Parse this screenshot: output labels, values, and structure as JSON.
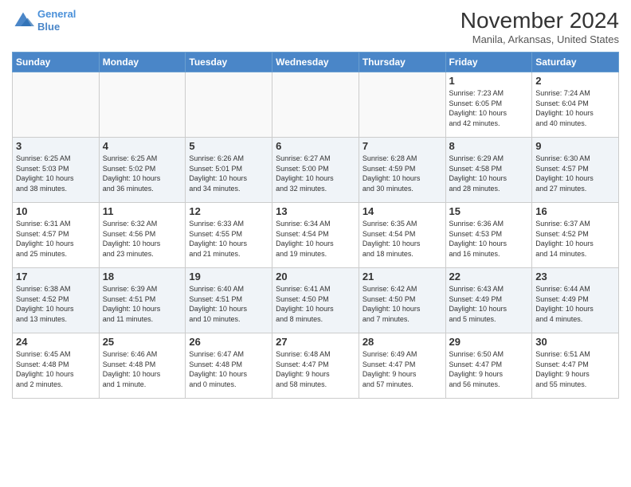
{
  "header": {
    "logo_line1": "General",
    "logo_line2": "Blue",
    "month": "November 2024",
    "location": "Manila, Arkansas, United States"
  },
  "days_of_week": [
    "Sunday",
    "Monday",
    "Tuesday",
    "Wednesday",
    "Thursday",
    "Friday",
    "Saturday"
  ],
  "weeks": [
    [
      {
        "day": "",
        "info": ""
      },
      {
        "day": "",
        "info": ""
      },
      {
        "day": "",
        "info": ""
      },
      {
        "day": "",
        "info": ""
      },
      {
        "day": "",
        "info": ""
      },
      {
        "day": "1",
        "info": "Sunrise: 7:23 AM\nSunset: 6:05 PM\nDaylight: 10 hours\nand 42 minutes."
      },
      {
        "day": "2",
        "info": "Sunrise: 7:24 AM\nSunset: 6:04 PM\nDaylight: 10 hours\nand 40 minutes."
      }
    ],
    [
      {
        "day": "3",
        "info": "Sunrise: 6:25 AM\nSunset: 5:03 PM\nDaylight: 10 hours\nand 38 minutes."
      },
      {
        "day": "4",
        "info": "Sunrise: 6:25 AM\nSunset: 5:02 PM\nDaylight: 10 hours\nand 36 minutes."
      },
      {
        "day": "5",
        "info": "Sunrise: 6:26 AM\nSunset: 5:01 PM\nDaylight: 10 hours\nand 34 minutes."
      },
      {
        "day": "6",
        "info": "Sunrise: 6:27 AM\nSunset: 5:00 PM\nDaylight: 10 hours\nand 32 minutes."
      },
      {
        "day": "7",
        "info": "Sunrise: 6:28 AM\nSunset: 4:59 PM\nDaylight: 10 hours\nand 30 minutes."
      },
      {
        "day": "8",
        "info": "Sunrise: 6:29 AM\nSunset: 4:58 PM\nDaylight: 10 hours\nand 28 minutes."
      },
      {
        "day": "9",
        "info": "Sunrise: 6:30 AM\nSunset: 4:57 PM\nDaylight: 10 hours\nand 27 minutes."
      }
    ],
    [
      {
        "day": "10",
        "info": "Sunrise: 6:31 AM\nSunset: 4:57 PM\nDaylight: 10 hours\nand 25 minutes."
      },
      {
        "day": "11",
        "info": "Sunrise: 6:32 AM\nSunset: 4:56 PM\nDaylight: 10 hours\nand 23 minutes."
      },
      {
        "day": "12",
        "info": "Sunrise: 6:33 AM\nSunset: 4:55 PM\nDaylight: 10 hours\nand 21 minutes."
      },
      {
        "day": "13",
        "info": "Sunrise: 6:34 AM\nSunset: 4:54 PM\nDaylight: 10 hours\nand 19 minutes."
      },
      {
        "day": "14",
        "info": "Sunrise: 6:35 AM\nSunset: 4:54 PM\nDaylight: 10 hours\nand 18 minutes."
      },
      {
        "day": "15",
        "info": "Sunrise: 6:36 AM\nSunset: 4:53 PM\nDaylight: 10 hours\nand 16 minutes."
      },
      {
        "day": "16",
        "info": "Sunrise: 6:37 AM\nSunset: 4:52 PM\nDaylight: 10 hours\nand 14 minutes."
      }
    ],
    [
      {
        "day": "17",
        "info": "Sunrise: 6:38 AM\nSunset: 4:52 PM\nDaylight: 10 hours\nand 13 minutes."
      },
      {
        "day": "18",
        "info": "Sunrise: 6:39 AM\nSunset: 4:51 PM\nDaylight: 10 hours\nand 11 minutes."
      },
      {
        "day": "19",
        "info": "Sunrise: 6:40 AM\nSunset: 4:51 PM\nDaylight: 10 hours\nand 10 minutes."
      },
      {
        "day": "20",
        "info": "Sunrise: 6:41 AM\nSunset: 4:50 PM\nDaylight: 10 hours\nand 8 minutes."
      },
      {
        "day": "21",
        "info": "Sunrise: 6:42 AM\nSunset: 4:50 PM\nDaylight: 10 hours\nand 7 minutes."
      },
      {
        "day": "22",
        "info": "Sunrise: 6:43 AM\nSunset: 4:49 PM\nDaylight: 10 hours\nand 5 minutes."
      },
      {
        "day": "23",
        "info": "Sunrise: 6:44 AM\nSunset: 4:49 PM\nDaylight: 10 hours\nand 4 minutes."
      }
    ],
    [
      {
        "day": "24",
        "info": "Sunrise: 6:45 AM\nSunset: 4:48 PM\nDaylight: 10 hours\nand 2 minutes."
      },
      {
        "day": "25",
        "info": "Sunrise: 6:46 AM\nSunset: 4:48 PM\nDaylight: 10 hours\nand 1 minute."
      },
      {
        "day": "26",
        "info": "Sunrise: 6:47 AM\nSunset: 4:48 PM\nDaylight: 10 hours\nand 0 minutes."
      },
      {
        "day": "27",
        "info": "Sunrise: 6:48 AM\nSunset: 4:47 PM\nDaylight: 9 hours\nand 58 minutes."
      },
      {
        "day": "28",
        "info": "Sunrise: 6:49 AM\nSunset: 4:47 PM\nDaylight: 9 hours\nand 57 minutes."
      },
      {
        "day": "29",
        "info": "Sunrise: 6:50 AM\nSunset: 4:47 PM\nDaylight: 9 hours\nand 56 minutes."
      },
      {
        "day": "30",
        "info": "Sunrise: 6:51 AM\nSunset: 4:47 PM\nDaylight: 9 hours\nand 55 minutes."
      }
    ]
  ]
}
